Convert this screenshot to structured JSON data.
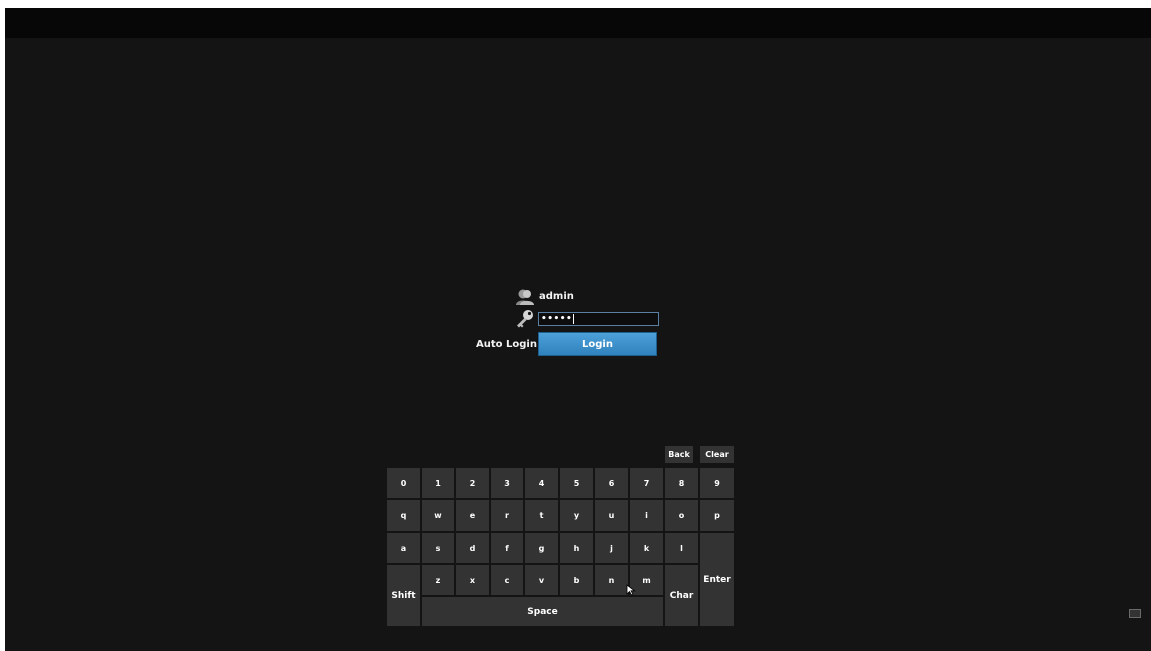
{
  "login": {
    "username": "admin",
    "password_mask": "•••••",
    "auto_login_label": "Auto Login",
    "login_button_label": "Login"
  },
  "keyboard": {
    "back_label": "Back",
    "clear_label": "Clear",
    "row_numbers": [
      "0",
      "1",
      "2",
      "3",
      "4",
      "5",
      "6",
      "7",
      "8",
      "9"
    ],
    "row_top": [
      "q",
      "w",
      "e",
      "r",
      "t",
      "y",
      "u",
      "i",
      "o",
      "p"
    ],
    "row_middle": [
      "a",
      "s",
      "d",
      "f",
      "g",
      "h",
      "j",
      "k",
      "l"
    ],
    "row_bottom": [
      "z",
      "x",
      "c",
      "v",
      "b",
      "n",
      "m"
    ],
    "shift_label": "Shift",
    "space_label": "Space",
    "char_label": "Char",
    "enter_label": "Enter"
  },
  "icons": {
    "user": "user-icon",
    "password": "key-icon",
    "keyboard_toggle": "keyboard-icon",
    "cursor": "mouse-pointer-icon"
  },
  "colors": {
    "background": "#141414",
    "topbar": "#070707",
    "key": "#333333",
    "login_button": "#3a90cc",
    "field_border": "#5a7fa3"
  }
}
